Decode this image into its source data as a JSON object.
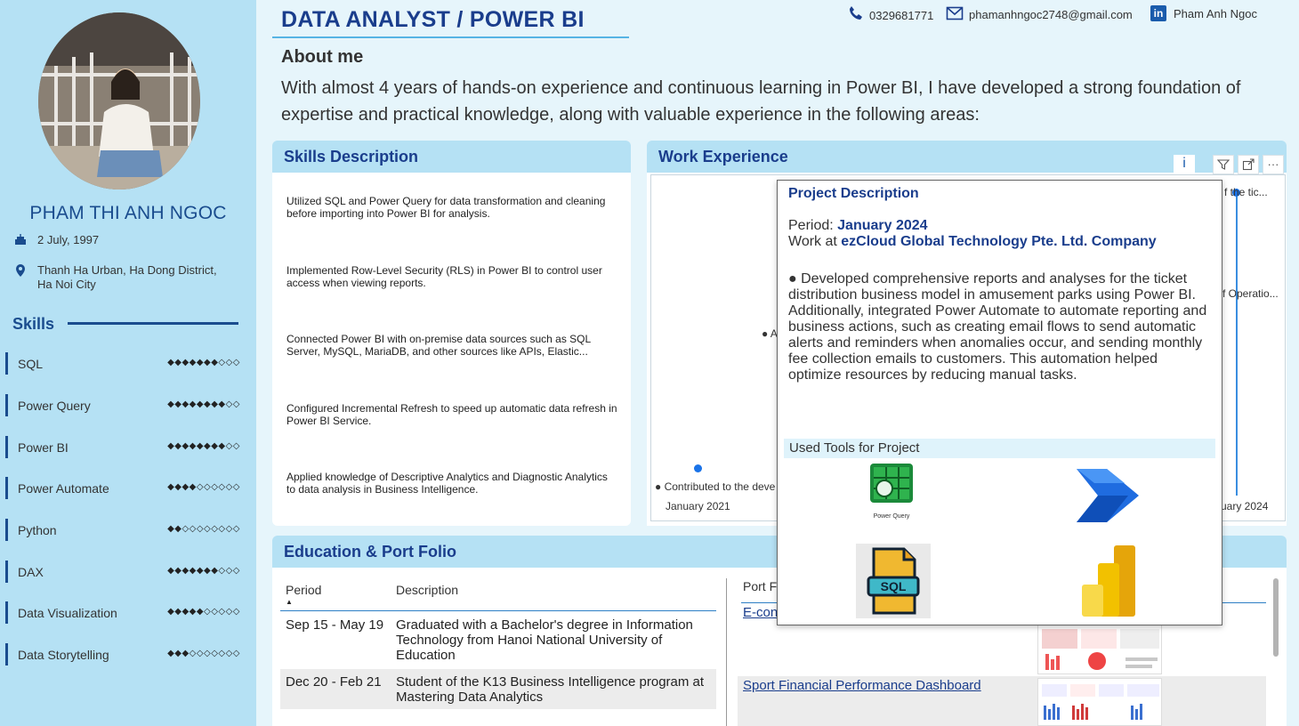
{
  "header": {
    "title": "DATA ANALYST / POWER BI",
    "phone": "0329681771",
    "email": "phamanhngoc2748@gmail.com",
    "linkedin_label": "Pham Anh Ngoc"
  },
  "profile": {
    "name": "PHAM THI ANH NGOC",
    "birthday": "2 July, 1997",
    "address_line1": "Thanh Ha Urban, Ha Dong District,",
    "address_line2": "Ha Noi City"
  },
  "skills": {
    "heading": "Skills",
    "items": [
      {
        "name": "SQL",
        "level": 7,
        "rating": "◆◆◆◆◆◆◆◇◇◇"
      },
      {
        "name": "Power Query",
        "level": 8,
        "rating": "◆◆◆◆◆◆◆◆◇◇"
      },
      {
        "name": "Power BI",
        "level": 8,
        "rating": "◆◆◆◆◆◆◆◆◇◇"
      },
      {
        "name": "Power Automate",
        "level": 4,
        "rating": "◆◆◆◆◇◇◇◇◇◇"
      },
      {
        "name": "Python",
        "level": 2,
        "rating": "◆◆◇◇◇◇◇◇◇◇"
      },
      {
        "name": "DAX",
        "level": 7,
        "rating": "◆◆◆◆◆◆◆◇◇◇"
      },
      {
        "name": "Data Visualization",
        "level": 5,
        "rating": "◆◆◆◆◆◇◇◇◇◇"
      },
      {
        "name": "Data Storytelling",
        "level": 3,
        "rating": "◆◆◆◇◇◇◇◇◇◇"
      }
    ]
  },
  "about": {
    "title": "About me",
    "text": "With almost 4 years of hands-on experience and continuous learning in Power BI, I have developed a strong foundation of expertise and practical knowledge, along with valuable experience in the following areas:"
  },
  "skills_description": {
    "heading": "Skills Description",
    "items": [
      "Utilized SQL and Power Query for data transformation and cleaning before importing into Power BI for analysis.",
      "Implemented Row-Level Security (RLS) in Power BI to control user access when viewing reports.",
      "Connected Power BI with on-premise data sources such as SQL Server, MySQL, MariaDB, and other sources like APIs, Elastic...",
      "Configured Incremental Refresh to speed up automatic data refresh in Power BI Service.",
      "Applied knowledge of Descriptive Analytics and Diagnostic Analytics to data analysis in Business Intelligence."
    ]
  },
  "work_experience": {
    "heading": "Work Experience",
    "toolbar": {
      "info": "i",
      "filter": "filter",
      "focus": "focus",
      "more": "···"
    },
    "timeline": {
      "start_label": "January 2021",
      "end_label": "uary 2024",
      "left_item": "● Contributed to the deve",
      "mid_item": "● A",
      "right_item1": "f the tic...",
      "right_item2": "f Operatio..."
    }
  },
  "tooltip": {
    "title": "Project Description",
    "period_label": "Period: ",
    "period_value": "January 2024",
    "work_label": "Work at ",
    "work_value": "ezCloud Global Technology Pte. Ltd. Company",
    "description": "● Developed comprehensive reports and analyses for the ticket distribution business model in amusement parks using Power BI. Additionally, integrated Power Automate to automate reporting and business actions, such as creating email flows to send automatic alerts and reminders when anomalies occur, and sending monthly fee collection emails to customers. This automation helped optimize resources by reducing manual tasks.",
    "tools_heading": "Used Tools for Project",
    "tools": [
      {
        "name": "Power Query",
        "icon": "power-query-icon",
        "caption": "Power Query"
      },
      {
        "name": "Power Automate",
        "icon": "power-automate-icon"
      },
      {
        "name": "SQL",
        "icon": "sql-file-icon",
        "label": "SQL"
      },
      {
        "name": "Power BI",
        "icon": "power-bi-icon"
      }
    ]
  },
  "education": {
    "heading": "Education & Port Folio",
    "columns": {
      "period": "Period",
      "description": "Description"
    },
    "rows": [
      {
        "period": "Sep 15 - May 19",
        "description": "Graduated with a Bachelor's degree in Information Technology from Hanoi National University of Education"
      },
      {
        "period": "Dec 20 - Feb 21",
        "description": "Student of the K13 Business Intelligence program at Mastering Data Analytics"
      }
    ]
  },
  "portfolio": {
    "column_head": "Port F",
    "items": [
      {
        "label": "E-con"
      },
      {
        "label": "Sport Financial Performance Dashboard"
      }
    ]
  },
  "colors": {
    "sidebar_bg": "#b5e1f4",
    "page_bg": "#e6f5fb",
    "accent_navy": "#1a3d8c",
    "accent_blue": "#1a73e8"
  }
}
